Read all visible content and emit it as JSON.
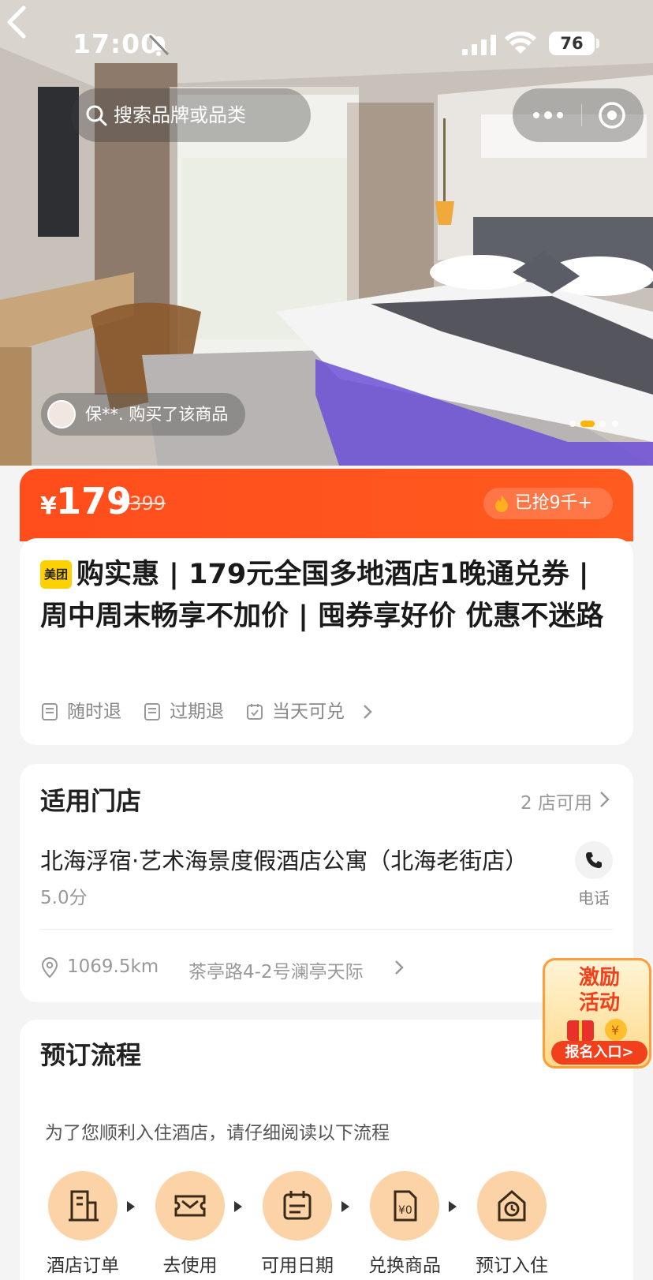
{
  "status_bar": {
    "time": "17:00",
    "battery": "76"
  },
  "header": {
    "search_placeholder": "搜索品牌或品类"
  },
  "gallery": {
    "buyer_text": "保**. 购买了该商品",
    "dot_count": 4,
    "active_dot": 1
  },
  "price": {
    "currency": "¥",
    "current": "179",
    "original": "¥399",
    "sold": "已抢9千+"
  },
  "product": {
    "brand_tag": "美团",
    "title": "购实惠 | 179元全国多地酒店1晚通兑券 | 周中周末畅享不加价 | 囤券享好价 优惠不迷路",
    "tags": [
      {
        "icon": "receipt-icon",
        "label": "随时退"
      },
      {
        "icon": "receipt-icon",
        "label": "过期退"
      },
      {
        "icon": "calendar-check-icon",
        "label": "当天可兑"
      }
    ]
  },
  "stores": {
    "heading": "适用门店",
    "count": "2 店可用",
    "name": "北海浮宿·艺术海景度假酒店公寓（北海老街店）",
    "score": "5.0分",
    "phone_label": "电话",
    "distance": "1069.5km",
    "address": "茶亭路4-2号澜亭天际"
  },
  "promo": {
    "title_line1": "激励",
    "title_line2": "活动",
    "button": "报名入口>"
  },
  "process": {
    "heading": "预订流程",
    "description": "为了您顺利入住酒店，请仔细阅读以下流程",
    "steps": [
      {
        "icon": "hotel-building-icon",
        "label": "酒店订单"
      },
      {
        "icon": "ticket-icon",
        "label": "去使用"
      },
      {
        "icon": "calendar-icon",
        "label": "可用日期"
      },
      {
        "icon": "voucher-icon",
        "label": "兑换商品"
      },
      {
        "icon": "clock-house-icon",
        "label": "预订入住"
      }
    ]
  },
  "colors": {
    "accent": "#ff4d1c",
    "step_circle": "#fbd3a6",
    "brand_yellow": "#ffd100"
  }
}
